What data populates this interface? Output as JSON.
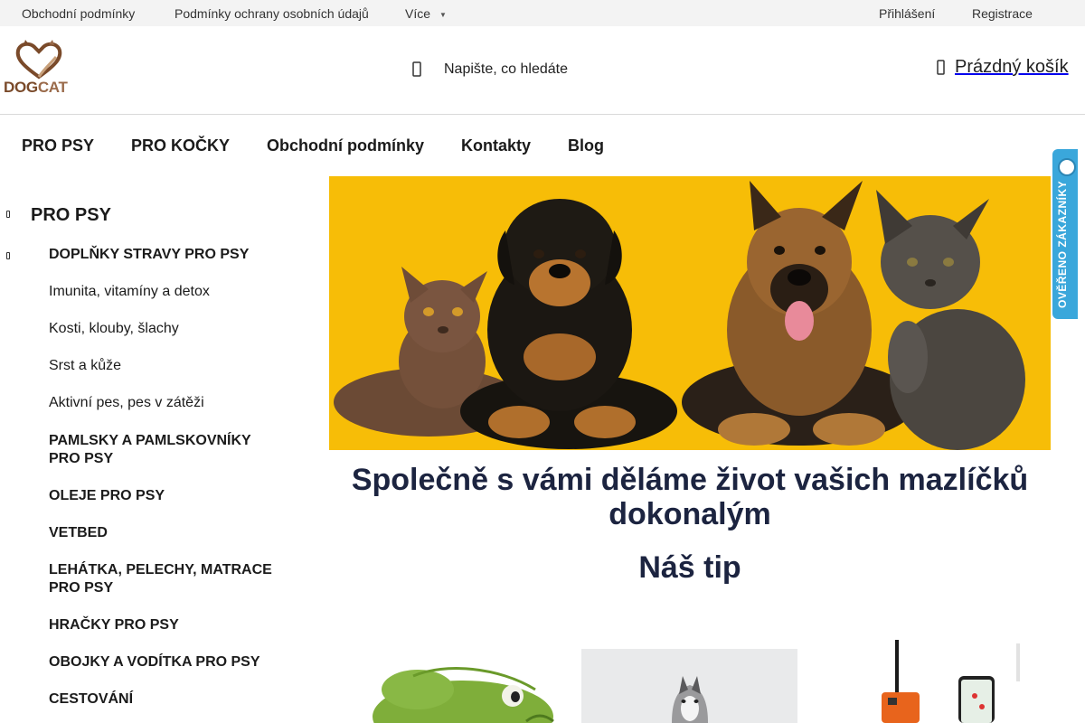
{
  "topbar": {
    "links": [
      "Obchodní podmínky",
      "Podmínky ochrany osobních údajů",
      "Více"
    ],
    "login": "Přihlášení",
    "register": "Registrace"
  },
  "header": {
    "logo": {
      "part1": "DOG",
      "part2": "CAT"
    },
    "search_placeholder": "Napište, co hledáte",
    "search_icon": "search-icon",
    "cart_label": "Prázdný košík",
    "cart_icon": "cart-icon"
  },
  "nav": {
    "items": [
      "PRO PSY",
      "PRO KOČKY",
      "Obchodní podmínky",
      "Kontakty",
      "Blog"
    ]
  },
  "sidebar": {
    "top": "PRO PSY",
    "category": "DOPLŇKY STRAVY PRO PSY",
    "subitems": [
      "Imunita, vitamíny a detox",
      "Kosti, klouby, šlachy",
      "Srst a kůže",
      "Aktivní pes, pes v zátěži"
    ],
    "categories": [
      "PAMLSKY A PAMLSKOVNÍKY PRO PSY",
      "OLEJE PRO PSY",
      "VETBED",
      "LEHÁTKA, PELECHY, MATRACE PRO PSY",
      "HRAČKY PRO PSY",
      "OBOJKY A VODÍTKA PRO PSY",
      "CESTOVÁNÍ"
    ]
  },
  "main": {
    "headline": "Společně s vámi děláme život vašich mazlíčků dokonalým",
    "tip_heading": "Náš tip"
  },
  "badge": {
    "label": "OVĚŘENO ZÁKAZNÍKY"
  },
  "colors": {
    "hero_bg": "#f7bd07",
    "heading": "#1c2440",
    "badge": "#3aa7db",
    "brand_brown": "#7a4a2a"
  }
}
